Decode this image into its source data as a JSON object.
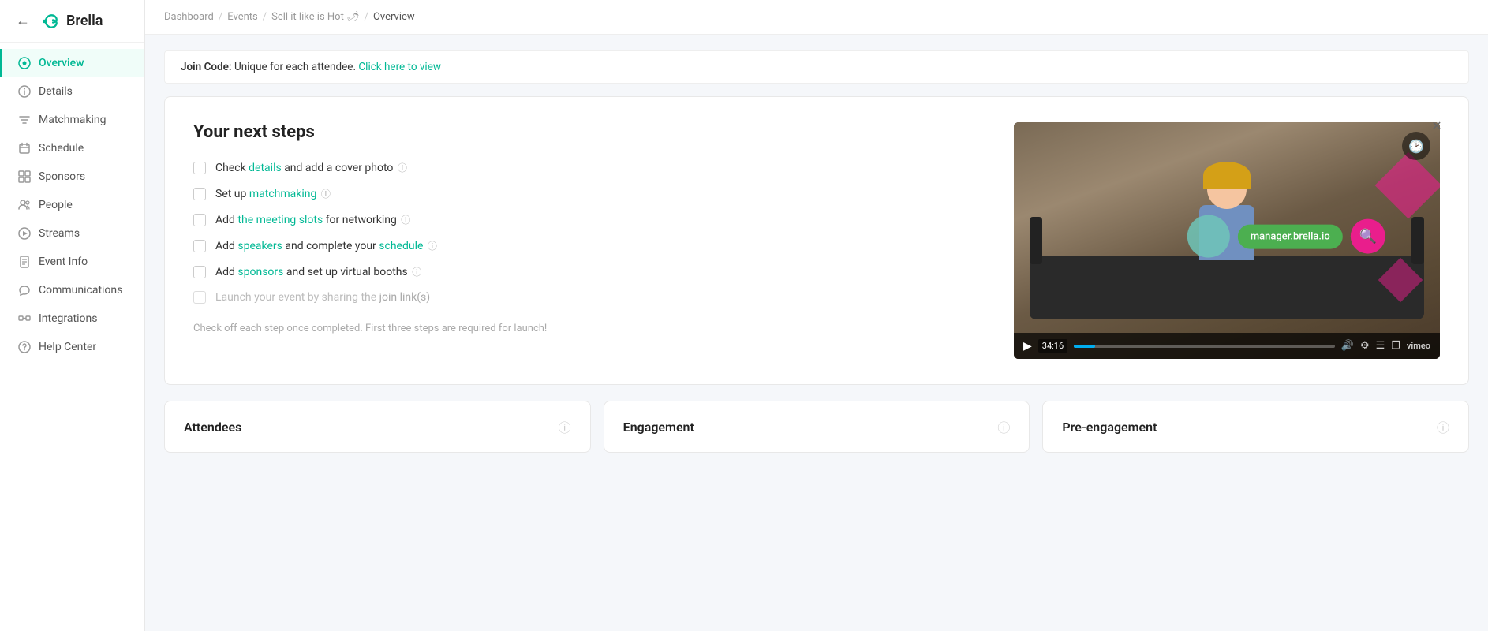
{
  "sidebar": {
    "logo_text": "Brella",
    "nav_items": [
      {
        "id": "overview",
        "label": "Overview",
        "icon": "circle-dot",
        "active": true
      },
      {
        "id": "details",
        "label": "Details",
        "icon": "info"
      },
      {
        "id": "matchmaking",
        "label": "Matchmaking",
        "icon": "sliders"
      },
      {
        "id": "schedule",
        "label": "Schedule",
        "icon": "calendar"
      },
      {
        "id": "sponsors",
        "label": "Sponsors",
        "icon": "grid"
      },
      {
        "id": "people",
        "label": "People",
        "icon": "user"
      },
      {
        "id": "streams",
        "label": "Streams",
        "icon": "play-circle"
      },
      {
        "id": "event-info",
        "label": "Event Info",
        "icon": "file"
      },
      {
        "id": "communications",
        "label": "Communications",
        "icon": "megaphone"
      },
      {
        "id": "integrations",
        "label": "Integrations",
        "icon": "puzzle"
      },
      {
        "id": "help-center",
        "label": "Help Center",
        "icon": "help-circle"
      }
    ]
  },
  "breadcrumb": {
    "items": [
      "Dashboard",
      "Events",
      "Sell it like is Hot 🌶",
      "Overview"
    ]
  },
  "join_code": {
    "label": "Join Code:",
    "description": "Unique for each attendee.",
    "link_text": "Click here to view"
  },
  "next_steps": {
    "title": "Your next steps",
    "steps": [
      {
        "id": "details",
        "text_before": "Check ",
        "link": "details",
        "text_after": " and add a cover photo",
        "has_info": true,
        "disabled": false
      },
      {
        "id": "matchmaking",
        "text_before": "Set up ",
        "link": "matchmaking",
        "text_after": "",
        "has_info": true,
        "disabled": false
      },
      {
        "id": "meeting-slots",
        "text_before": "Add ",
        "link": "the meeting slots",
        "text_after": " for networking",
        "has_info": true,
        "disabled": false
      },
      {
        "id": "speakers",
        "text_before": "Add ",
        "link": "speakers",
        "text_after": " and complete your ",
        "link2": "schedule",
        "has_info": true,
        "disabled": false
      },
      {
        "id": "sponsors",
        "text_before": "Add ",
        "link": "sponsors",
        "text_after": " and set up virtual booths",
        "has_info": true,
        "disabled": false
      },
      {
        "id": "launch",
        "text_before": "Launch your event by sharing the ",
        "link": "join link(s)",
        "text_after": "",
        "has_info": false,
        "disabled": true
      }
    ],
    "footnote": "Check off each step once completed. First three steps are required for launch!"
  },
  "video": {
    "domain_pill": "manager.brella.io",
    "time": "34:16",
    "close_label": "×"
  },
  "stats": [
    {
      "id": "attendees",
      "label": "Attendees"
    },
    {
      "id": "engagement",
      "label": "Engagement"
    },
    {
      "id": "pre-engagement",
      "label": "Pre-engagement"
    }
  ],
  "colors": {
    "green": "#00b894",
    "pink": "#e91e8c",
    "teal": "#6ec6b8"
  }
}
